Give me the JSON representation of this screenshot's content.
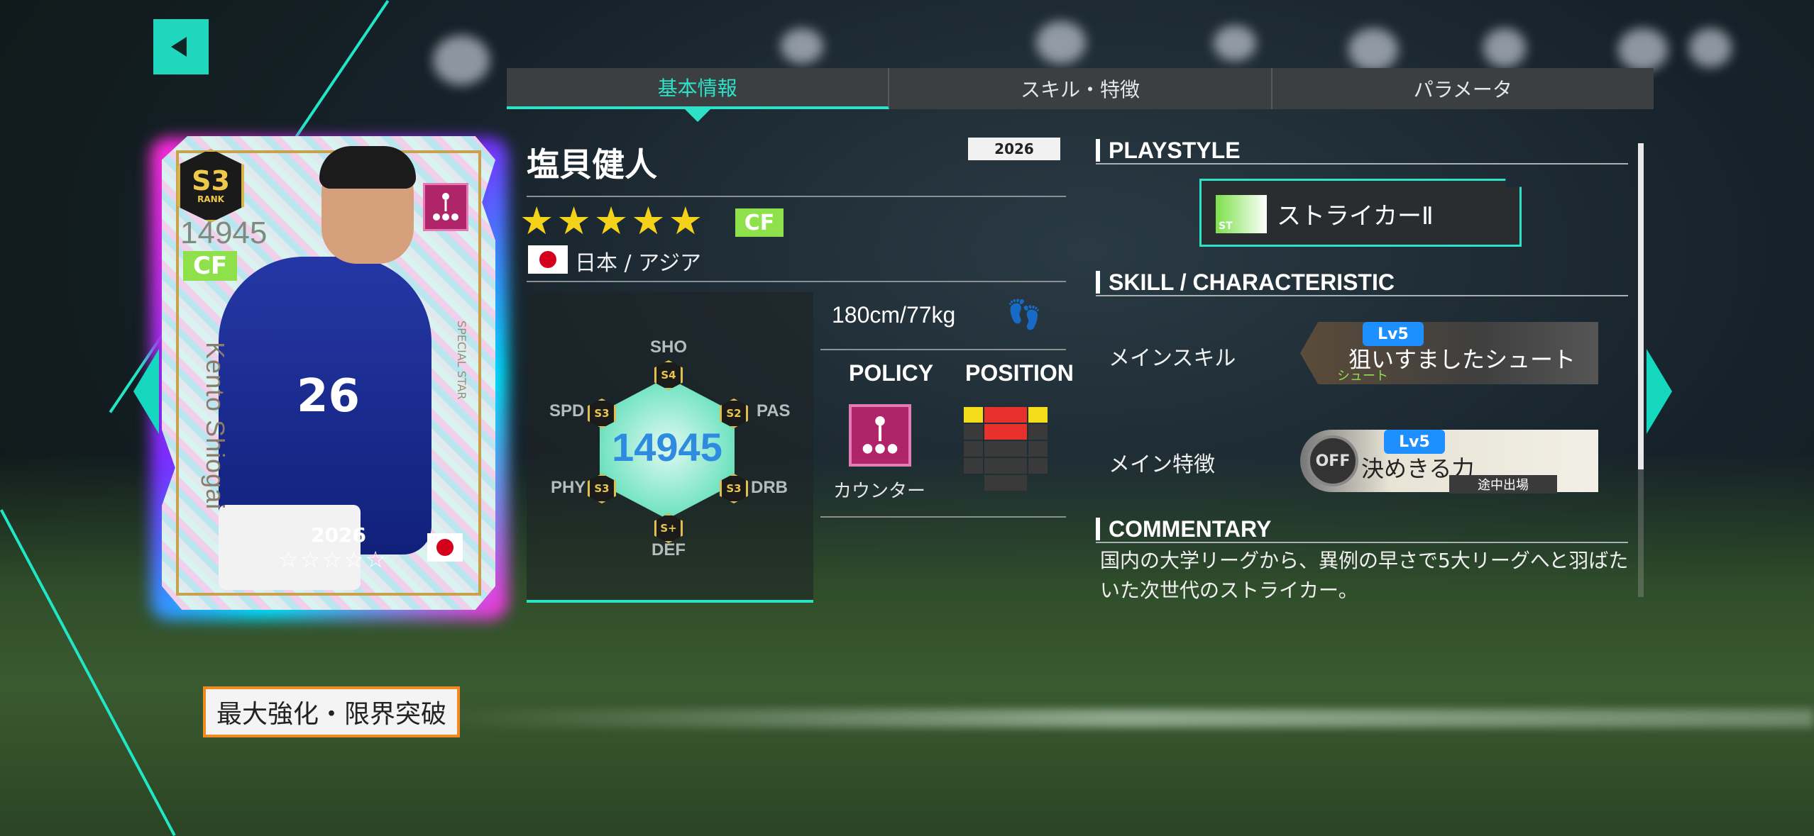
{
  "tabs": [
    {
      "label": "基本情報",
      "active": true
    },
    {
      "label": "スキル・特徴",
      "active": false
    },
    {
      "label": "パラメータ",
      "active": false
    }
  ],
  "card": {
    "rank": "S3",
    "rank_label": "RANK",
    "rating": "14945",
    "position": "CF",
    "name": "Kento Shiogai",
    "edition": "SPECIAL STAR",
    "jersey_number": "26",
    "year": "2026",
    "stars": "☆☆☆☆☆"
  },
  "upgrade_button": "最大強化・限界突破",
  "player": {
    "name": "塩貝健人",
    "year": "2026",
    "stars": "★★★★★",
    "position": "CF",
    "nation": "日本 / アジア",
    "height_weight": "180cm/77kg",
    "overall": "14945"
  },
  "stats": {
    "SHO": "S4",
    "PAS": "S2",
    "DRB": "S3",
    "DEF": "S+",
    "PHY": "S3",
    "SPD": "S3"
  },
  "policy": {
    "heading": "POLICY",
    "label": "カウンター"
  },
  "position_heading": "POSITION",
  "playstyle": {
    "heading": "PLAYSTYLE",
    "icon_label": "ST",
    "name": "ストライカーⅡ"
  },
  "skill_section": {
    "heading": "SKILL / CHARACTERISTIC",
    "main_skill_label": "メインスキル",
    "main_skill_level": "Lv5",
    "main_skill_name": "狙いすましたシュート",
    "main_skill_type": "シュート",
    "main_trait_label": "メイン特徴",
    "main_trait_level": "Lv5",
    "main_trait_name": "決めきる力",
    "main_trait_status": "OFF",
    "main_trait_condition": "途中出場"
  },
  "commentary": {
    "heading": "COMMENTARY",
    "text": "国内の大学リーグから、異例の早さで5大リーグへと羽ばたいた次世代のストライカー。"
  },
  "colors": {
    "accent": "#2de2c6",
    "position_badge": "#8ee14b",
    "star": "#f5d21a",
    "upgrade_border": "#f28a1f"
  }
}
